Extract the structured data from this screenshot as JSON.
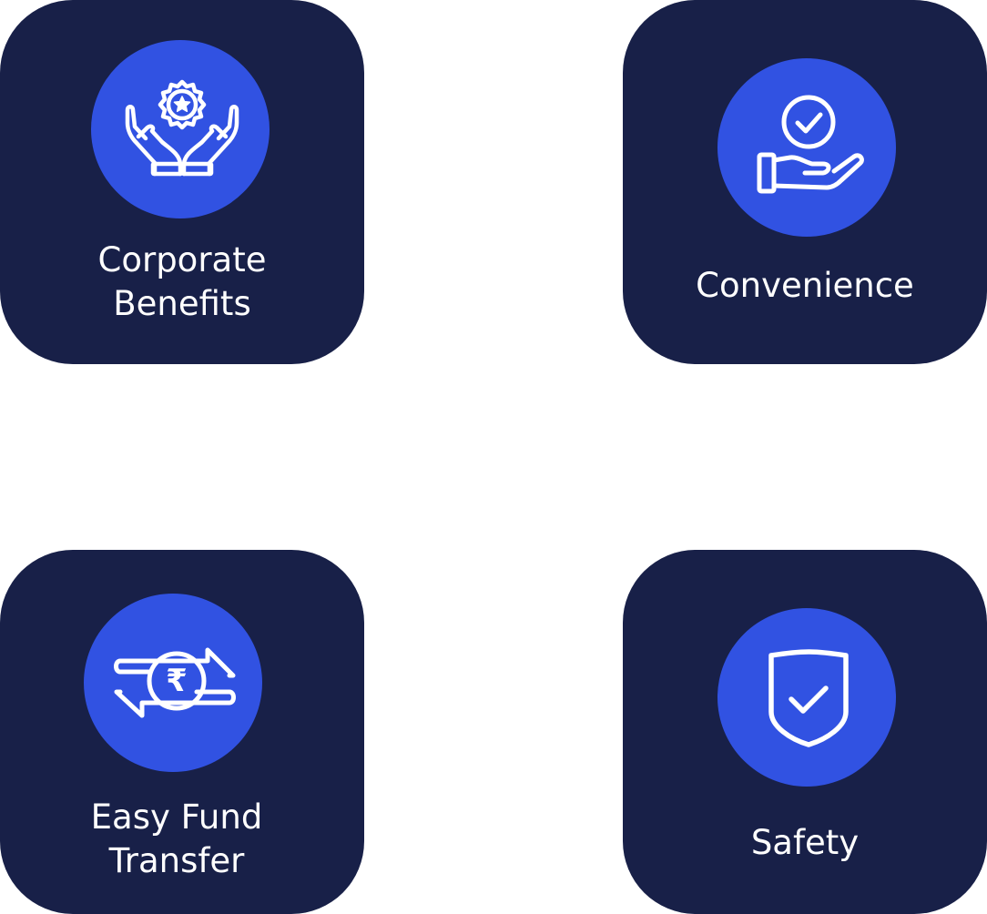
{
  "colors": {
    "background": "#ffffff",
    "card": "#182048",
    "icon_circle": "#3152e2",
    "icon_stroke": "#ffffff",
    "text": "#ffffff"
  },
  "cards": [
    {
      "icon": "hands-badge-icon",
      "label_lines": [
        "Corporate",
        "Benefits"
      ]
    },
    {
      "icon": "hand-check-icon",
      "label_lines": [
        "Convenience"
      ]
    },
    {
      "icon": "rupee-transfer-icon",
      "label_lines": [
        "Easy Fund",
        "Transfer"
      ],
      "currency_symbol": "₹"
    },
    {
      "icon": "shield-check-icon",
      "label_lines": [
        "Safety"
      ]
    }
  ]
}
